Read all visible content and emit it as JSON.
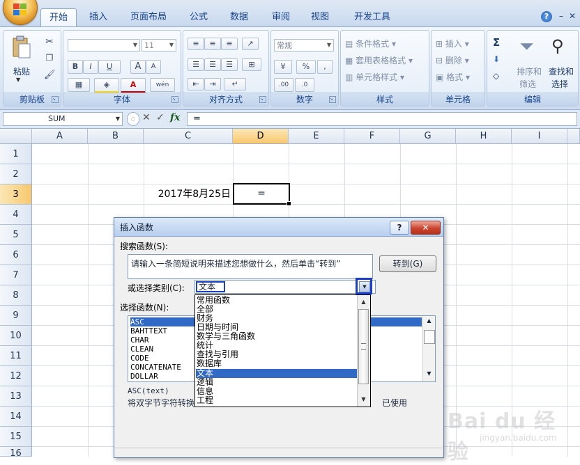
{
  "app": {
    "tabs": [
      "开始",
      "插入",
      "页面布局",
      "公式",
      "数据",
      "审阅",
      "视图",
      "开发工具"
    ],
    "active_tab": "开始"
  },
  "ribbon": {
    "clipboard": {
      "paste": "粘贴",
      "label": "剪贴板"
    },
    "font": {
      "size": "11",
      "bold": "B",
      "italic": "I",
      "underline": "U",
      "grow": "A",
      "shrink": "A",
      "label": "字体",
      "phonetic": "wén"
    },
    "alignment": {
      "label": "对齐方式"
    },
    "number": {
      "format": "常规",
      "label": "数字",
      "percent": "%",
      "comma": ",",
      "inc_decimal": ".00",
      "dec_decimal": ".0"
    },
    "styles": {
      "conditional": "条件格式",
      "table": "套用表格格式",
      "cell_styles": "单元格样式",
      "label": "样式"
    },
    "cells": {
      "insert": "插入",
      "delete": "删除",
      "format": "格式",
      "label": "单元格"
    },
    "editing": {
      "sort": "排序和",
      "sort2": "筛选",
      "find": "查找和",
      "find2": "选择",
      "label": "编辑",
      "sum": "Σ"
    }
  },
  "formula_bar": {
    "name_box": "SUM",
    "fx": "fx",
    "formula": "="
  },
  "grid": {
    "columns": [
      "A",
      "B",
      "C",
      "D",
      "E",
      "F",
      "G",
      "H",
      "I"
    ],
    "rows": [
      "1",
      "2",
      "3",
      "4",
      "5",
      "6",
      "7",
      "8",
      "9",
      "10",
      "11",
      "12",
      "13",
      "14",
      "15",
      "16"
    ],
    "cell_c3": "2017年8月25日",
    "cell_d3": "="
  },
  "dialog": {
    "title": "插入函数",
    "help": "?",
    "close": "✕",
    "search_label": "搜索函数(S):",
    "search_value": "请输入一条简短说明来描述您想做什么，然后单击“转到”",
    "goto": "转到(G)",
    "category_label": "或选择类别(C):",
    "category_value": "文本",
    "select_label": "选择函数(N):",
    "functions": [
      "ASC",
      "BAHTTEXT",
      "CHAR",
      "CLEAN",
      "CODE",
      "CONCATENATE",
      "DOLLAR"
    ],
    "selected_function": "ASC",
    "signature": "ASC(text)",
    "description": "将双字节字符转换",
    "description_tail": "已使用"
  },
  "category_dropdown": {
    "items": [
      "常用函数",
      "全部",
      "财务",
      "日期与时间",
      "数学与三角函数",
      "统计",
      "查找与引用",
      "数据库",
      "文本",
      "逻辑",
      "信息",
      "工程"
    ],
    "selected": "文本"
  },
  "watermark": {
    "text": "Bai du 经验",
    "sub": "jingyan.baidu.com"
  },
  "colors": {
    "selection": "#3169c6",
    "highlight_box": "#1c3fc7",
    "ribbon_text": "#15428b"
  }
}
